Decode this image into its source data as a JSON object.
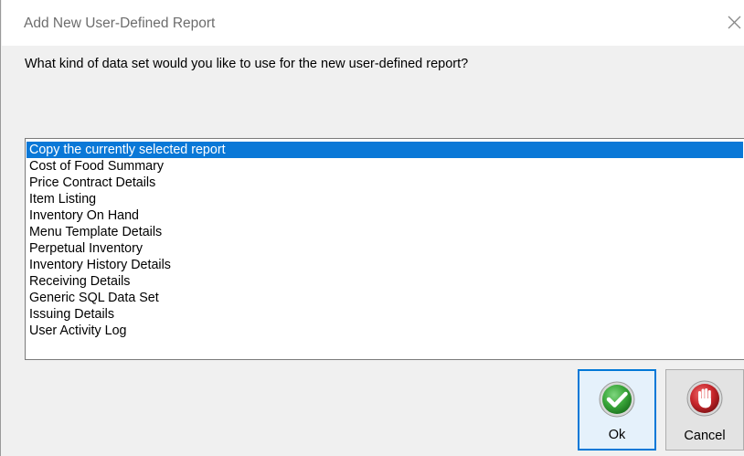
{
  "dialog": {
    "title": "Add New User-Defined Report",
    "prompt": "What kind of data set would you like to use for the new user-defined report?"
  },
  "list": {
    "selected_index": 0,
    "items": [
      {
        "label": "Copy the currently selected report"
      },
      {
        "label": "Cost of Food Summary"
      },
      {
        "label": "Price Contract Details"
      },
      {
        "label": "Item Listing"
      },
      {
        "label": "Inventory On Hand"
      },
      {
        "label": "Menu Template Details"
      },
      {
        "label": "Perpetual Inventory"
      },
      {
        "label": "Inventory History Details"
      },
      {
        "label": "Receiving Details"
      },
      {
        "label": "Generic SQL Data Set"
      },
      {
        "label": "Issuing Details"
      },
      {
        "label": "User Activity Log"
      }
    ]
  },
  "buttons": {
    "ok": {
      "label": "Ok",
      "icon": "check-icon",
      "color": "#3aa63a"
    },
    "cancel": {
      "label": "Cancel",
      "icon": "stop-hand-icon",
      "color": "#c8262b"
    }
  },
  "colors": {
    "selection": "#0a78d7",
    "default_button_border": "#0078d7"
  }
}
